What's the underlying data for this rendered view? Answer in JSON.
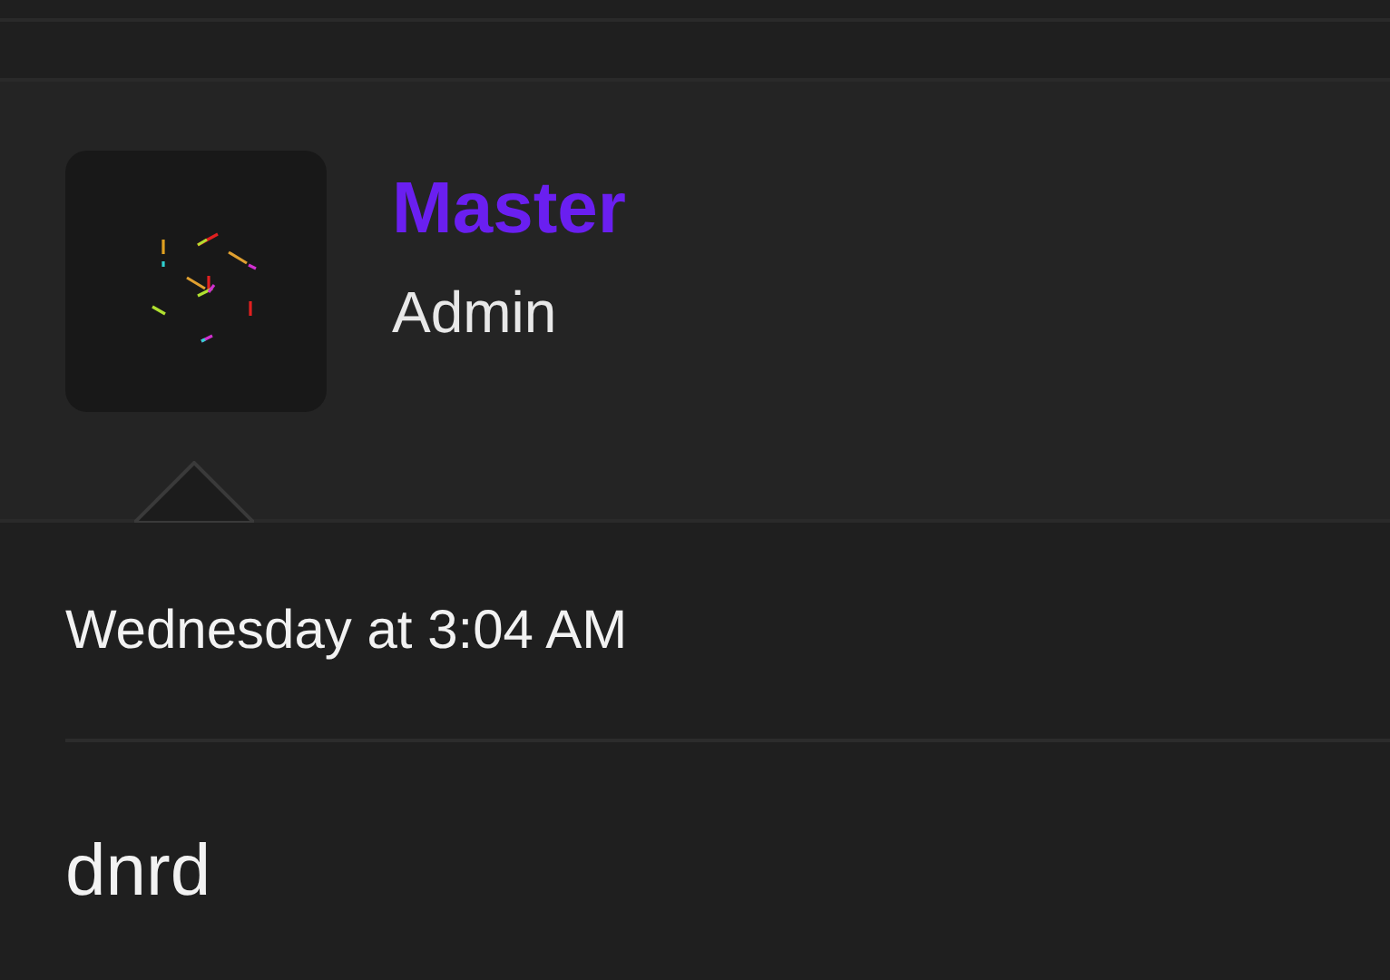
{
  "profile": {
    "name": "Master",
    "role": "Admin"
  },
  "message": {
    "time": "Wednesday at 3:04 AM",
    "text": "dnrd"
  }
}
